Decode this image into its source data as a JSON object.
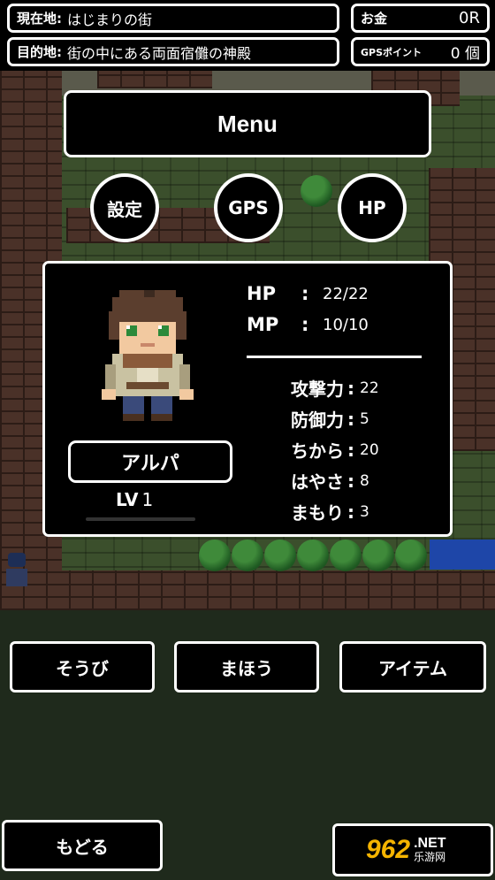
{
  "hud": {
    "location_label": "現在地:",
    "location_value": "はじまりの街",
    "money_label": "お金",
    "money_value": "0R",
    "destination_label": "目的地:",
    "destination_value": "街の中にある両面宿儺の神殿",
    "gps_label": "GPSポイント",
    "gps_value": "0 個"
  },
  "menu": {
    "title": "Menu",
    "buttons": [
      "設定",
      "GPS",
      "HP"
    ]
  },
  "character": {
    "name": "アルパ",
    "level_label": "LV",
    "level": "1",
    "exp_fraction": 0.0,
    "hp_label": "HP",
    "hp": "22/22",
    "mp_label": "MP",
    "mp": "10/10",
    "attributes": [
      {
        "label": "攻撃力",
        "value": "22"
      },
      {
        "label": "防御力",
        "value": "5"
      },
      {
        "label": "ちから",
        "value": "20"
      },
      {
        "label": "はやさ",
        "value": "8"
      },
      {
        "label": "まもり",
        "value": "3"
      }
    ]
  },
  "commands": {
    "equip": "そうび",
    "magic": "まほう",
    "items": "アイテム",
    "back": "もどる"
  },
  "watermark": {
    "number": "962",
    "suffix": ".NET",
    "sub": "乐游网"
  }
}
